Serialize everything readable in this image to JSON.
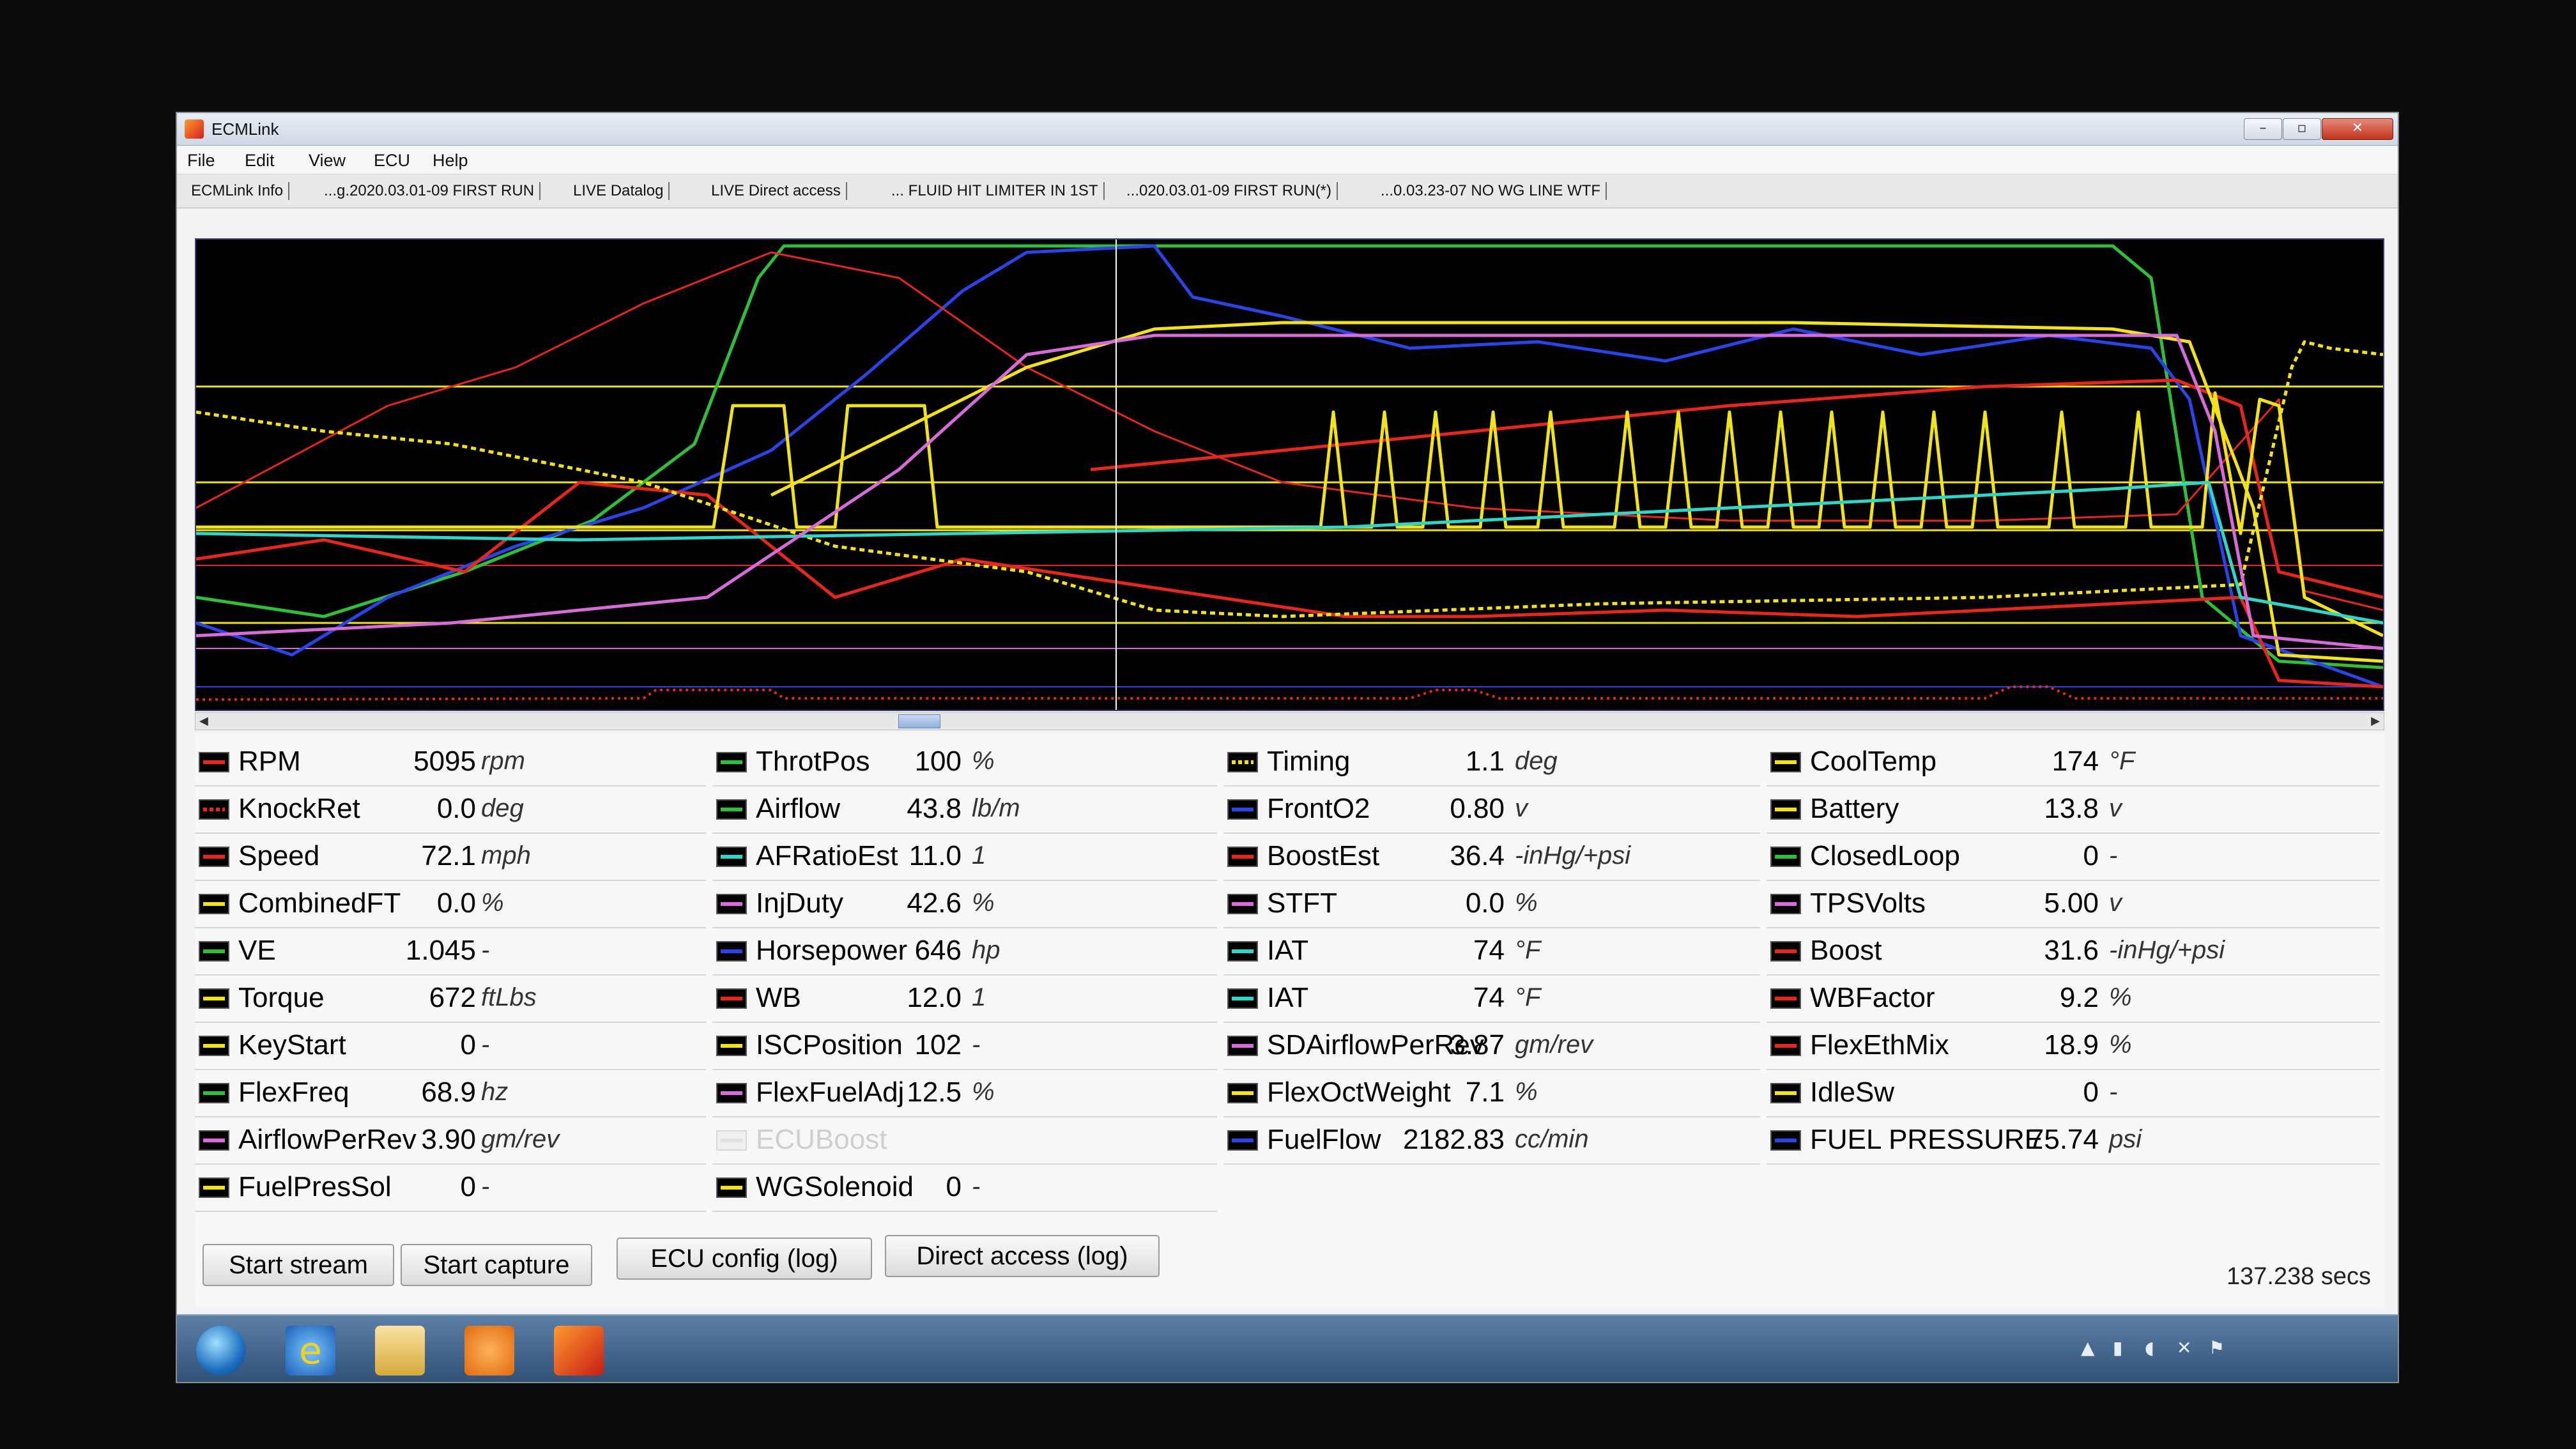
{
  "window": {
    "title": "ECMLink",
    "controls": {
      "minimize": "–",
      "maximize": "▫",
      "close": "✕"
    }
  },
  "menu": [
    "File",
    "Edit",
    "View",
    "ECU",
    "Help"
  ],
  "tabs": [
    "ECMLink Info",
    "...g.2020.03.01-09 FIRST RUN",
    "LIVE Datalog",
    "LIVE Direct access",
    "... FLUID HIT LIMITER IN 1ST",
    "...020.03.01-09 FIRST RUN(*)",
    "...0.03.23-07 NO WG LINE WTF"
  ],
  "colors": {
    "red": "#e8271c",
    "green": "#2fbf3a",
    "yellow": "#f2e21b",
    "blue": "#2a44e8",
    "magenta": "#d66bd9",
    "cyan": "#2fd6c8"
  },
  "params": {
    "col1": [
      {
        "label": "RPM",
        "value": "5095",
        "unit": "rpm",
        "color": "red",
        "style": "solid"
      },
      {
        "label": "KnockRet",
        "value": "0.0",
        "unit": "deg",
        "color": "red",
        "style": "dotted"
      },
      {
        "label": "Speed",
        "value": "72.1",
        "unit": "mph",
        "color": "red",
        "style": "solid"
      },
      {
        "label": "CombinedFT",
        "value": "0.0",
        "unit": "%",
        "color": "yellow",
        "style": "solid"
      },
      {
        "label": "VE",
        "value": "1.045",
        "unit": "-",
        "color": "green",
        "style": "solid"
      },
      {
        "label": "Torque",
        "value": "672",
        "unit": "ftLbs",
        "color": "yellow",
        "style": "solid"
      },
      {
        "label": "KeyStart",
        "value": "0",
        "unit": "-",
        "color": "yellow",
        "style": "solid"
      },
      {
        "label": "FlexFreq",
        "value": "68.9",
        "unit": "hz",
        "color": "green",
        "style": "solid"
      },
      {
        "label": "AirflowPerRev",
        "value": "3.90",
        "unit": "gm/rev",
        "color": "magenta",
        "style": "solid"
      },
      {
        "label": "FuelPresSol",
        "value": "0",
        "unit": "-",
        "color": "yellow",
        "style": "solid"
      }
    ],
    "col2": [
      {
        "label": "ThrotPos",
        "value": "100",
        "unit": "%",
        "color": "green",
        "style": "solid"
      },
      {
        "label": "Airflow",
        "value": "43.8",
        "unit": "lb/m",
        "color": "green",
        "style": "solid"
      },
      {
        "label": "AFRatioEst",
        "value": "11.0",
        "unit": "1",
        "color": "cyan",
        "style": "solid"
      },
      {
        "label": "InjDuty",
        "value": "42.6",
        "unit": "%",
        "color": "magenta",
        "style": "solid"
      },
      {
        "label": "Horsepower",
        "value": "646",
        "unit": "hp",
        "color": "blue",
        "style": "solid"
      },
      {
        "label": "WB",
        "value": "12.0",
        "unit": "1",
        "color": "red",
        "style": "solid"
      },
      {
        "label": "ISCPosition",
        "value": "102",
        "unit": "-",
        "color": "yellow",
        "style": "solid"
      },
      {
        "label": "FlexFuelAdj",
        "value": "12.5",
        "unit": "%",
        "color": "magenta",
        "style": "solid"
      },
      {
        "label": "ECUBoost",
        "value": "",
        "unit": "",
        "color": "yellow",
        "style": "solid",
        "dim": true
      },
      {
        "label": "WGSolenoid",
        "value": "0",
        "unit": "-",
        "color": "yellow",
        "style": "solid"
      }
    ],
    "col3": [
      {
        "label": "Timing",
        "value": "1.1",
        "unit": "deg",
        "color": "yellow",
        "style": "dotted"
      },
      {
        "label": "FrontO2",
        "value": "0.80",
        "unit": "v",
        "color": "blue",
        "style": "solid"
      },
      {
        "label": "BoostEst",
        "value": "36.4",
        "unit": "-inHg/+psi",
        "color": "red",
        "style": "solid"
      },
      {
        "label": "STFT",
        "value": "0.0",
        "unit": "%",
        "color": "magenta",
        "style": "solid"
      },
      {
        "label": "IAT",
        "value": "74",
        "unit": "°F",
        "color": "cyan",
        "style": "solid"
      },
      {
        "label": "IAT",
        "value": "74",
        "unit": "°F",
        "color": "cyan",
        "style": "solid"
      },
      {
        "label": "SDAirflowPerRev",
        "value": "3.87",
        "unit": "gm/rev",
        "color": "magenta",
        "style": "solid"
      },
      {
        "label": "FlexOctWeight",
        "value": "7.1",
        "unit": "%",
        "color": "yellow",
        "style": "solid"
      },
      {
        "label": "FuelFlow",
        "value": "2182.83",
        "unit": "cc/min",
        "color": "blue",
        "style": "solid"
      }
    ],
    "col4": [
      {
        "label": "CoolTemp",
        "value": "174",
        "unit": "°F",
        "color": "yellow",
        "style": "solid"
      },
      {
        "label": "Battery",
        "value": "13.8",
        "unit": "v",
        "color": "yellow",
        "style": "solid"
      },
      {
        "label": "ClosedLoop",
        "value": "0",
        "unit": "-",
        "color": "green",
        "style": "solid"
      },
      {
        "label": "TPSVolts",
        "value": "5.00",
        "unit": "v",
        "color": "magenta",
        "style": "solid"
      },
      {
        "label": "Boost",
        "value": "31.6",
        "unit": "-inHg/+psi",
        "color": "red",
        "style": "solid"
      },
      {
        "label": "WBFactor",
        "value": "9.2",
        "unit": "%",
        "color": "red",
        "style": "solid"
      },
      {
        "label": "FlexEthMix",
        "value": "18.9",
        "unit": "%",
        "color": "red",
        "style": "solid"
      },
      {
        "label": "IdleSw",
        "value": "0",
        "unit": "-",
        "color": "yellow",
        "style": "solid"
      },
      {
        "label": "FUEL PRESSURE",
        "value": "75.74",
        "unit": "psi",
        "color": "blue",
        "style": "solid"
      }
    ]
  },
  "elapsed": "137.238 secs",
  "buttons": {
    "start_stream": "Start stream",
    "start_capture": "Start capture",
    "ecu_config": "ECU config (log)",
    "direct_access": "Direct access (log)"
  }
}
